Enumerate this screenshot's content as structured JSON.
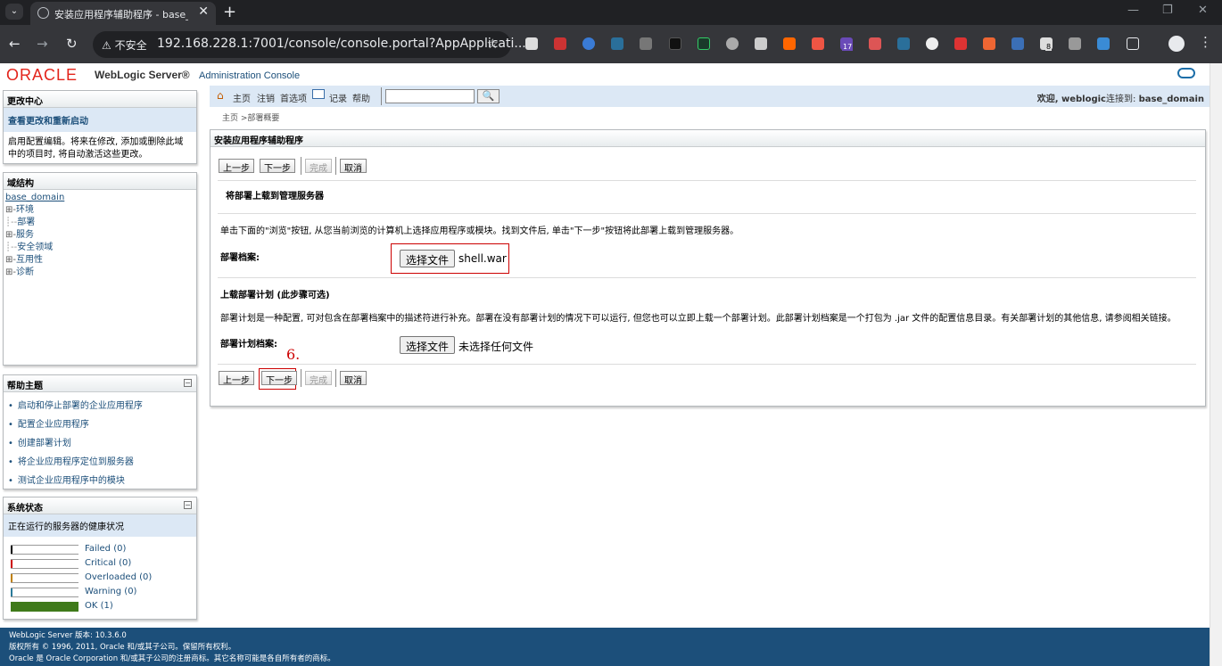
{
  "browser": {
    "tab_title": "安装应用程序辅助程序 - base_",
    "tab_close": "✕",
    "new_tab": "+",
    "security_label": "⚠ 不安全",
    "url": "192.168.228.1:7001/console/console.portal?AppApplicati...",
    "ext_badge_17": "17",
    "ext_badge_8": "8"
  },
  "header": {
    "oracle": "ORACLE",
    "product": "WebLogic Server®",
    "console": "Administration Console"
  },
  "change_center": {
    "title": "更改中心",
    "link": "查看更改和重新启动",
    "text": "启用配置编辑。将来在修改, 添加或删除此域中的项目时, 将自动激活这些更改。"
  },
  "domain_structure": {
    "title": "域结构",
    "root": "base_domain",
    "items": [
      {
        "prefix": "⊞-",
        "label": "环境"
      },
      {
        "prefix": "┊--",
        "label": "部署"
      },
      {
        "prefix": "⊞-",
        "label": "服务"
      },
      {
        "prefix": "┊--",
        "label": "安全领域"
      },
      {
        "prefix": "⊞-",
        "label": "互用性"
      },
      {
        "prefix": "⊞-",
        "label": "诊断"
      }
    ]
  },
  "help_topics": {
    "title": "帮助主题",
    "collapse": "−",
    "items": [
      "启动和停止部署的企业应用程序",
      "配置企业应用程序",
      "创建部署计划",
      "将企业应用程序定位到服务器",
      "测试企业应用程序中的模块"
    ]
  },
  "system_status": {
    "title": "系统状态",
    "collapse": "−",
    "subtitle": "正在运行的服务器的健康状况",
    "rows": [
      {
        "label": "Failed (0)",
        "color": "#000000",
        "fill": 0
      },
      {
        "label": "Critical (0)",
        "color": "#cc0000",
        "fill": 0
      },
      {
        "label": "Overloaded (0)",
        "color": "#c08000",
        "fill": 0
      },
      {
        "label": "Warning (0)",
        "color": "#2a7a9a",
        "fill": 0
      },
      {
        "label": "OK (1)",
        "color": "#3f7a1a",
        "fill": 1
      }
    ]
  },
  "topnav": {
    "home": "主页",
    "logout": "注销",
    "preferences": "首选项",
    "record": "记录",
    "help": "帮助",
    "search_value": "",
    "search_btn": "🔍",
    "welcome": "欢迎, weblogic",
    "connected_label": "连接到: ",
    "connected_domain": "base_domain"
  },
  "breadcrumb": {
    "home": "主页",
    "sep": " >",
    "current": "部署概要"
  },
  "wizard": {
    "title": "安装应用程序辅助程序",
    "btn_back": "上一步",
    "btn_next": "下一步",
    "btn_finish": "完成",
    "btn_cancel": "取消",
    "upload_title": "将部署上载到管理服务器",
    "upload_desc": "单击下面的\"浏览\"按钮, 从您当前浏览的计算机上选择应用程序或模块。找到文件后, 单击\"下一步\"按钮将此部署上载到管理服务器。",
    "archive_label": "部署档案:",
    "choose_file": "选择文件",
    "archive_file": "shell.war",
    "plan_title": "上载部署计划 (此步骤可选)",
    "plan_desc": "部署计划是一种配置, 可对包含在部署档案中的描述符进行补充。部署在没有部署计划的情况下可以运行, 但您也可以立即上载一个部署计划。此部署计划档案是一个打包为 .jar 文件的配置信息目录。有关部署计划的其他信息, 请参阅相关链接。",
    "plan_label": "部署计划档案:",
    "plan_file": "未选择任何文件",
    "step_annotation": "6."
  },
  "footer": {
    "version": "WebLogic Server 版本: 10.3.6.0",
    "copyright": "版权所有 © 1996, 2011, Oracle 和/或其子公司。保留所有权利。",
    "trademark": "Oracle 是 Oracle Corporation 和/或其子公司的注册商标。其它名称可能是各自所有者的商标。"
  }
}
